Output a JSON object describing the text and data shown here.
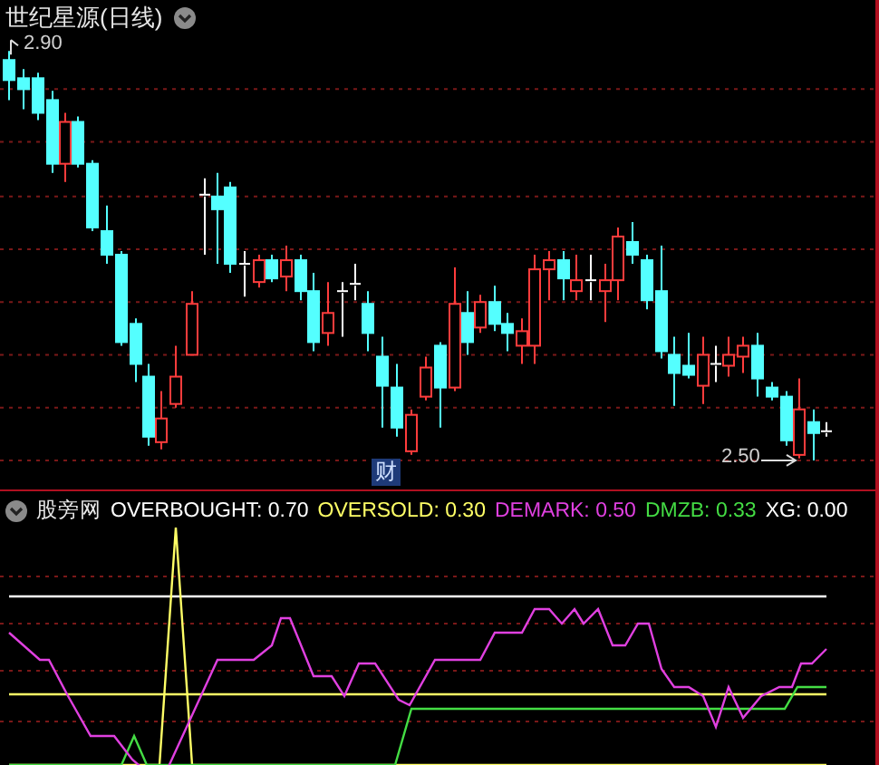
{
  "title": "世纪星源(日线)",
  "price_chart": {
    "high_label": "2.90",
    "low_label": "2.50",
    "marker": "财"
  },
  "indicator": {
    "name": "股旁网",
    "legend": [
      {
        "text": "OVERBOUGHT: 0.70",
        "color": "#ffffff"
      },
      {
        "text": "OVERSOLD: 0.30",
        "color": "#ffff66"
      },
      {
        "text": "DEMARK: 0.50",
        "color": "#e040e0"
      },
      {
        "text": "DMZB: 0.33",
        "color": "#44dd44"
      },
      {
        "text": "XG: 0.00",
        "color": "#ffffff"
      }
    ]
  }
}
